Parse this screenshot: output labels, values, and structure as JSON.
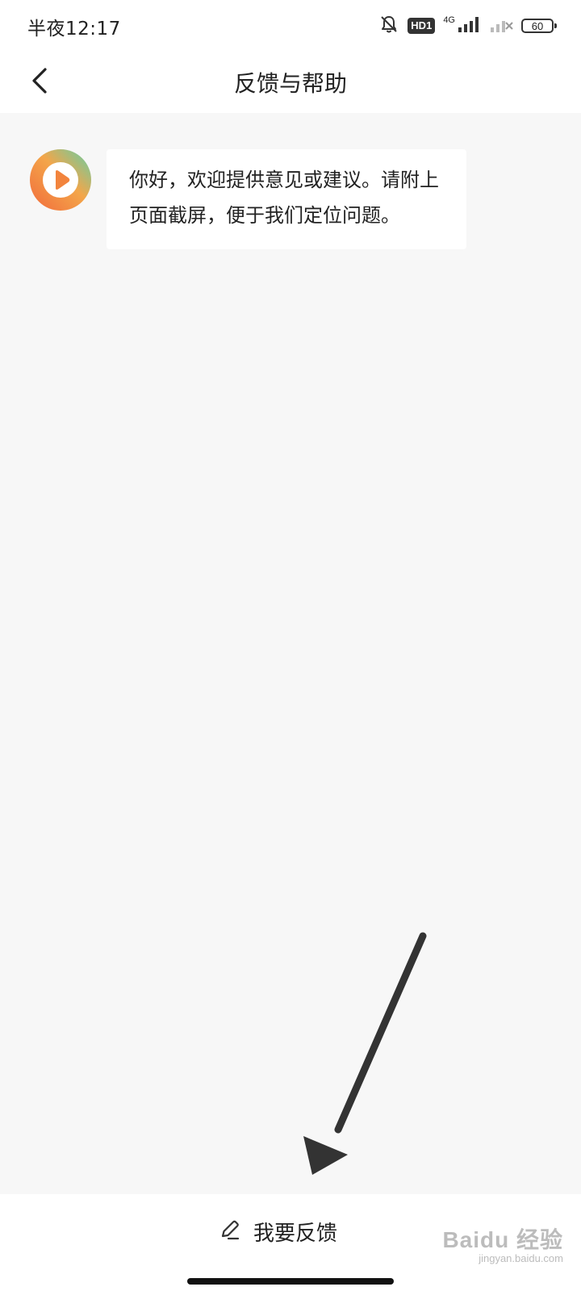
{
  "status_bar": {
    "time": "半夜12:17",
    "hd_badge": "HD1",
    "network": "4G",
    "battery": "60"
  },
  "nav": {
    "title": "反馈与帮助"
  },
  "chat": {
    "messages": [
      {
        "text": "你好，欢迎提供意见或建议。请附上页面截屏，便于我们定位问题。"
      }
    ]
  },
  "bottom": {
    "feedback_label": "我要反馈"
  },
  "watermark": {
    "main": "Baidu 经验",
    "sub": "jingyan.baidu.com"
  },
  "colors": {
    "background": "#f7f7f7",
    "surface": "#ffffff",
    "avatar_gradient_start": "#5fd0a8",
    "avatar_gradient_end": "#f26a3b",
    "annotation_arrow": "#333333"
  },
  "icons": {
    "back": "chevron-left-icon",
    "mute": "bell-off-icon",
    "edit": "pencil-icon",
    "avatar": "play-logo-icon"
  }
}
